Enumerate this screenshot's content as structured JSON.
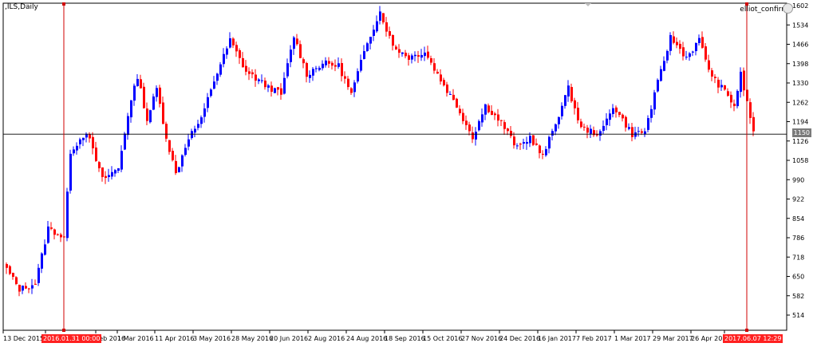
{
  "header": {
    "symbol": ",ILS,Daily",
    "indicator": "elliot_confirm"
  },
  "markers": {
    "price_line": "1150",
    "left_time": "2016.01.31 00:00",
    "right_time": "2017.06.07 12:29"
  },
  "colors": {
    "bull": "#0000ff",
    "bear": "#ff0000",
    "vertical_line": "#d00000",
    "price_line": "#000000",
    "axis": "#000000"
  },
  "chart_data": {
    "type": "candlestick",
    "y_ticks": [
      514,
      582,
      650,
      718,
      786,
      854,
      922,
      990,
      1058,
      1126,
      1194,
      1262,
      1330,
      1398,
      1466,
      1534,
      1602
    ],
    "x_ticks": [
      "13 Dec 2015",
      "2016.01.31 00:00",
      "Feb 2016",
      "1 Mar 2016",
      "11 Apr 2016",
      "3 May 2016",
      "28 May 2016",
      "20 Jun 2016",
      "2 Aug 2016",
      "24 Aug 2016",
      "18 Sep 2016",
      "15 Oct 2016",
      "27 Nov 2016",
      "24 Dec 2016",
      "16 Jan 2017",
      "7 Feb 2017",
      "1 Mar 2017",
      "29 Mar 2017",
      "26 Apr 2017",
      "2017.06.07 12:29"
    ],
    "ylim": [
      475,
      1618
    ],
    "price_line": 1150,
    "grid": false,
    "waypoints": [
      {
        "bar": 0,
        "close": 675
      },
      {
        "bar": 4,
        "close": 605
      },
      {
        "bar": 9,
        "close": 625
      },
      {
        "bar": 13,
        "close": 820
      },
      {
        "bar": 18,
        "close": 785
      },
      {
        "bar": 20,
        "close": 1090
      },
      {
        "bar": 25,
        "close": 1160
      },
      {
        "bar": 30,
        "close": 990
      },
      {
        "bar": 35,
        "close": 1030
      },
      {
        "bar": 38,
        "close": 1220
      },
      {
        "bar": 41,
        "close": 1355
      },
      {
        "bar": 44,
        "close": 1200
      },
      {
        "bar": 47,
        "close": 1310
      },
      {
        "bar": 50,
        "close": 1140
      },
      {
        "bar": 53,
        "close": 1010
      },
      {
        "bar": 57,
        "close": 1140
      },
      {
        "bar": 61,
        "close": 1200
      },
      {
        "bar": 64,
        "close": 1310
      },
      {
        "bar": 70,
        "close": 1480
      },
      {
        "bar": 75,
        "close": 1370
      },
      {
        "bar": 80,
        "close": 1330
      },
      {
        "bar": 86,
        "close": 1290
      },
      {
        "bar": 90,
        "close": 1495
      },
      {
        "bar": 94,
        "close": 1360
      },
      {
        "bar": 99,
        "close": 1400
      },
      {
        "bar": 104,
        "close": 1390
      },
      {
        "bar": 108,
        "close": 1290
      },
      {
        "bar": 113,
        "close": 1475
      },
      {
        "bar": 117,
        "close": 1580
      },
      {
        "bar": 121,
        "close": 1460
      },
      {
        "bar": 126,
        "close": 1420
      },
      {
        "bar": 131,
        "close": 1440
      },
      {
        "bar": 136,
        "close": 1340
      },
      {
        "bar": 141,
        "close": 1250
      },
      {
        "bar": 146,
        "close": 1140
      },
      {
        "bar": 150,
        "close": 1250
      },
      {
        "bar": 155,
        "close": 1190
      },
      {
        "bar": 160,
        "close": 1100
      },
      {
        "bar": 164,
        "close": 1140
      },
      {
        "bar": 168,
        "close": 1070
      },
      {
        "bar": 172,
        "close": 1190
      },
      {
        "bar": 176,
        "close": 1310
      },
      {
        "bar": 180,
        "close": 1170
      },
      {
        "bar": 186,
        "close": 1150
      },
      {
        "bar": 190,
        "close": 1250
      },
      {
        "bar": 196,
        "close": 1150
      },
      {
        "bar": 200,
        "close": 1160
      },
      {
        "bar": 204,
        "close": 1330
      },
      {
        "bar": 208,
        "close": 1490
      },
      {
        "bar": 213,
        "close": 1420
      },
      {
        "bar": 217,
        "close": 1480
      },
      {
        "bar": 221,
        "close": 1350
      },
      {
        "bar": 225,
        "close": 1300
      },
      {
        "bar": 228,
        "close": 1250
      },
      {
        "bar": 230,
        "close": 1360
      },
      {
        "bar": 234,
        "close": 1160
      }
    ]
  }
}
